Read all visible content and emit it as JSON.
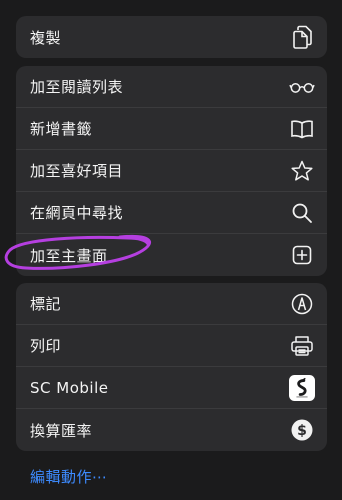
{
  "menu": {
    "group1": [
      {
        "label": "複製",
        "icon": "copy-icon"
      }
    ],
    "group2": [
      {
        "label": "加至閱讀列表",
        "icon": "glasses-icon"
      },
      {
        "label": "新增書籤",
        "icon": "book-icon"
      },
      {
        "label": "加至喜好項目",
        "icon": "star-icon"
      },
      {
        "label": "在網頁中尋找",
        "icon": "search-icon"
      },
      {
        "label": "加至主畫面",
        "icon": "add-square-icon"
      }
    ],
    "group3": [
      {
        "label": "標記",
        "icon": "markup-icon"
      },
      {
        "label": "列印",
        "icon": "printer-icon"
      },
      {
        "label": "SC Mobile",
        "icon": "sc-mobile-app-icon"
      },
      {
        "label": "換算匯率",
        "icon": "dollar-icon"
      }
    ],
    "edit_actions": "編輯動作⋯"
  },
  "colors": {
    "background": "#1b1b1c",
    "group": "#2c2c2e",
    "accent": "#3d8bff",
    "annotation": "#b53fe0"
  }
}
